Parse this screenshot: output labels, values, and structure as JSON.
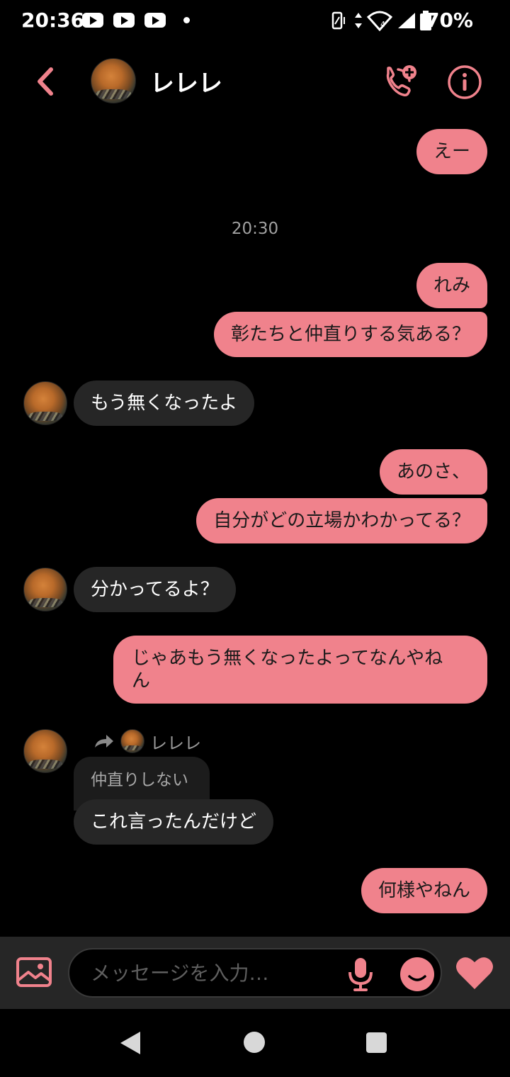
{
  "status_bar": {
    "time": "20:36",
    "battery": "70%",
    "icons": [
      "youtube-icon",
      "youtube-icon",
      "youtube-icon",
      "dot-icon",
      "vibrate-icon",
      "data-arrows-icon",
      "wifi-icon",
      "signal-icon",
      "battery-icon"
    ]
  },
  "header": {
    "contact_name": "レレレ",
    "back_icon": "chevron-left-icon",
    "call_icon": "phone-add-icon",
    "info_icon": "info-icon"
  },
  "colors": {
    "accent": "#f0828c",
    "incoming_bubble": "#262626",
    "background": "#000000"
  },
  "messages": {
    "timestamp": "20:30",
    "out1": "えー",
    "out2": "れみ",
    "out3": "彰たちと仲直りする気ある？",
    "in1": "もう無くなったよ",
    "out4": "あのさ、",
    "out5": "自分がどの立場かわかってる？",
    "in2": "分かってるよ？",
    "out6_line1": "じゃあもう無くなったよってなんやね",
    "out6_line2": "ん",
    "forward_name": "レレレ",
    "quoted_text": "仲直りしない",
    "in3": "これ言ったんだけど",
    "out7": "何様やねん"
  },
  "composer": {
    "placeholder": "メッセージを入力…"
  }
}
